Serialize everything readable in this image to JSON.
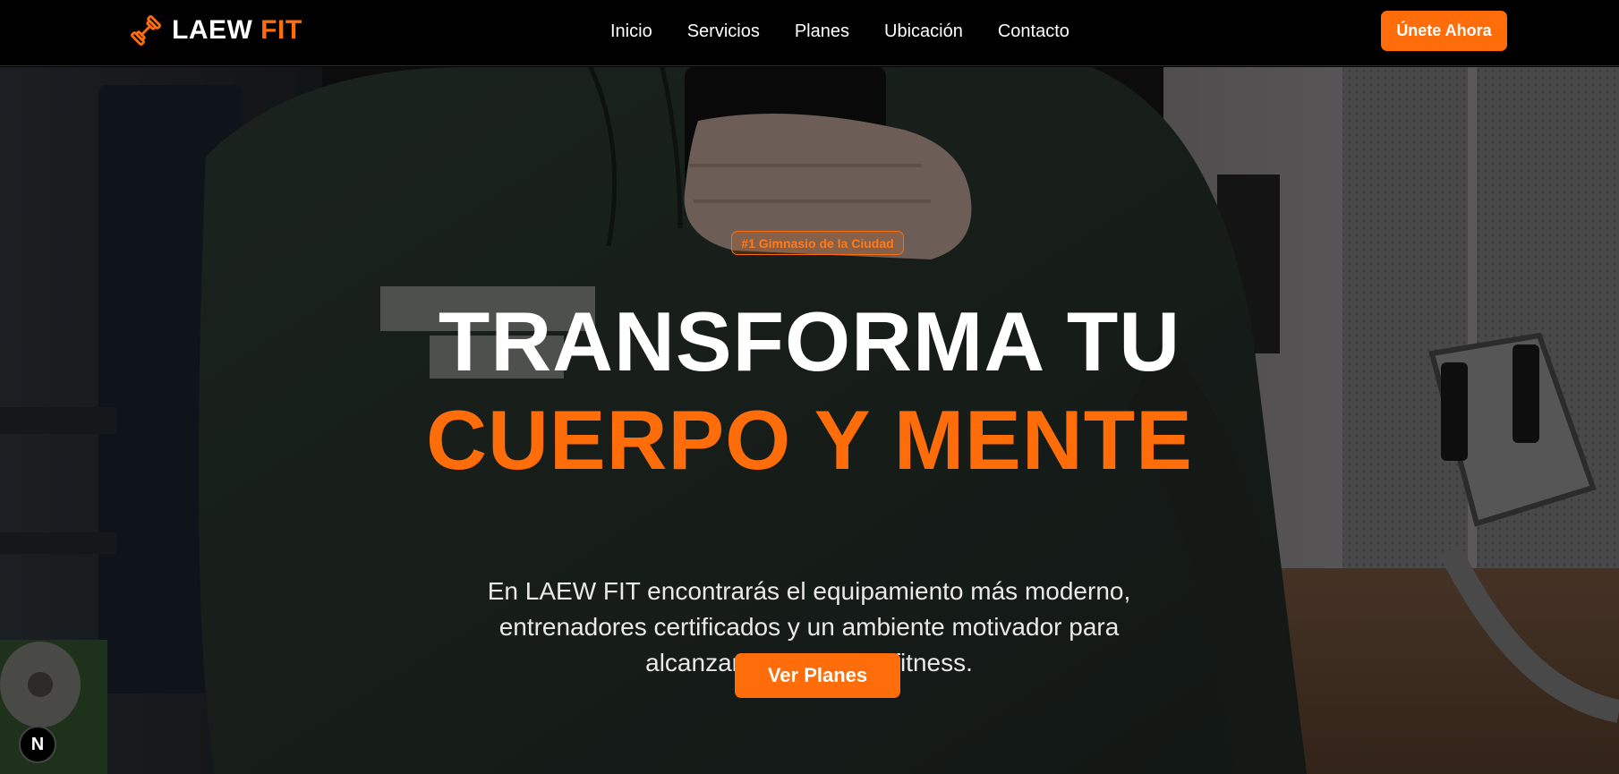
{
  "brand": {
    "name_main": "LAEW",
    "name_accent": "FIT",
    "icon": "dumbbell-icon",
    "accent_color": "#ff6d0a"
  },
  "nav": {
    "links": [
      "Inicio",
      "Servicios",
      "Planes",
      "Ubicación",
      "Contacto"
    ],
    "cta_label": "Únete Ahora"
  },
  "hero": {
    "badge": "#1 Gimnasio de la Ciudad",
    "headline_line1": "TRANSFORMA TU",
    "headline_line2": "CUERPO Y MENTE",
    "subtitle": "En LAEW FIT encontrarás el equipamiento más moderno, entrenadores certificados y un ambiente motivador para alcanzar tus objetivos fitness.",
    "cta_label": "Ver Planes",
    "background": "gym-photo"
  },
  "dev_badge": {
    "label": "N",
    "icon": "nextjs-icon"
  }
}
